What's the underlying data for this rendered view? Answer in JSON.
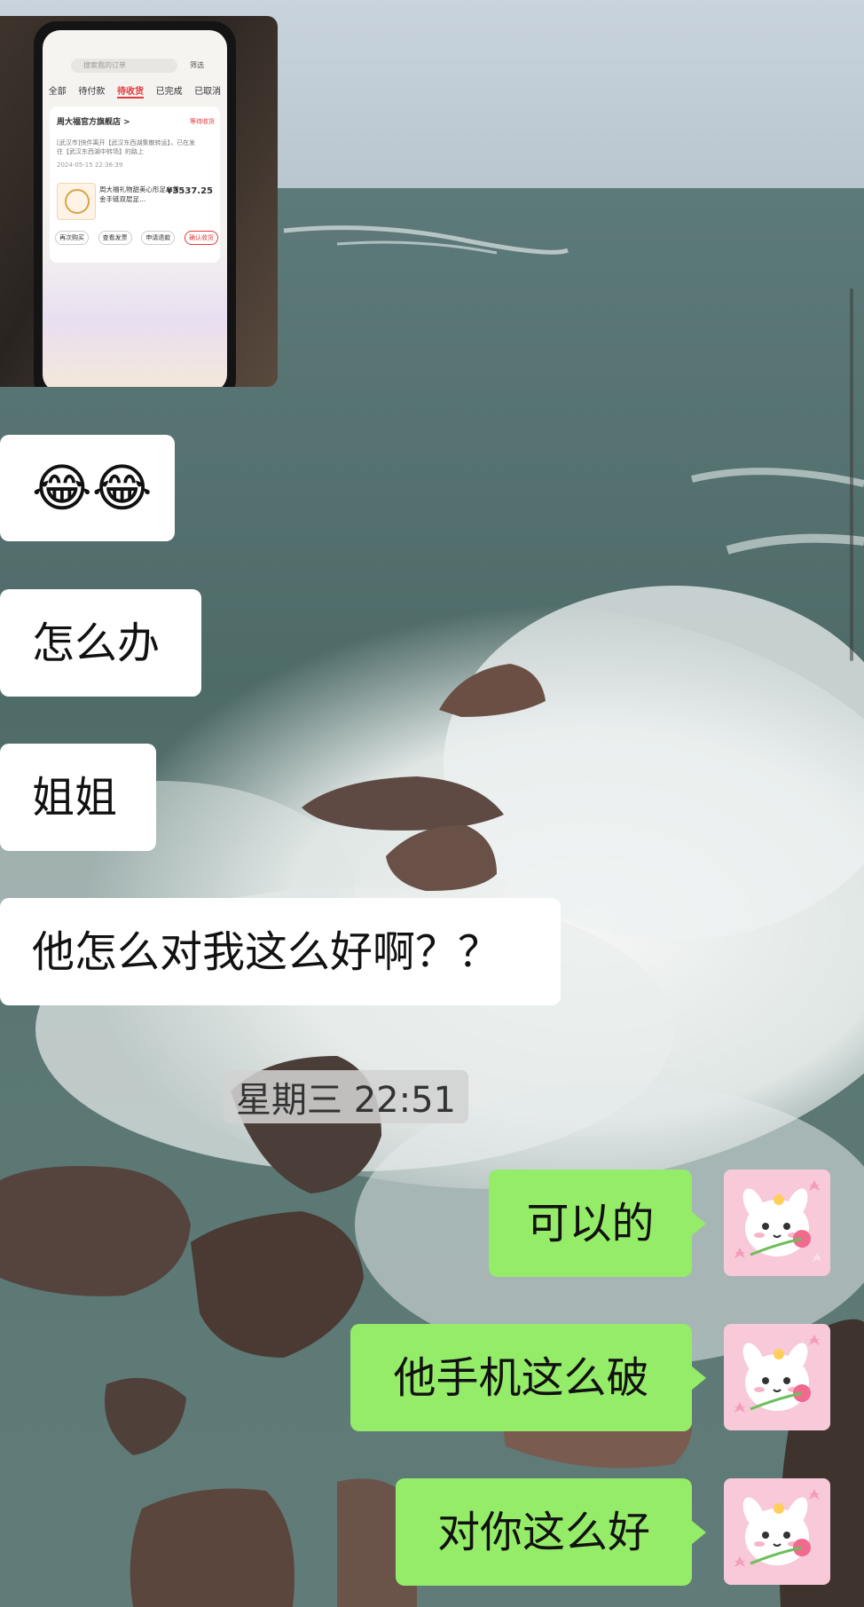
{
  "chat": {
    "image_message": {
      "screen": {
        "search_placeholder": "搜索我的订单",
        "filter_label": "筛选",
        "tabs": [
          "全部",
          "待付款",
          "待收货",
          "已完成",
          "已取消"
        ],
        "active_tab": "待收货",
        "store_name": "周大福官方旗舰店 >",
        "order_status": "等待收货",
        "tracking_text": "[武汉市]快件离开【武汉东西湖集散转运】，已在发往【武汉东西湖中转场】的路上",
        "tracking_time": "2024-05-15 22:36:39",
        "product_name": "周大福礼物甜美心形足心黄金手链双层足...",
        "price": "¥3537.25",
        "buttons": [
          "再次购买",
          "查看发票",
          "申请退款",
          "确认收货"
        ]
      }
    },
    "incoming": [
      {
        "text": "😂😂"
      },
      {
        "text": "怎么办"
      },
      {
        "text": "姐姐"
      },
      {
        "text": "他怎么对我这么好啊？？"
      }
    ],
    "timestamp": "星期三 22:51",
    "outgoing": [
      {
        "text": "可以的"
      },
      {
        "text": "他手机这么破"
      },
      {
        "text": "对你这么好"
      }
    ]
  },
  "colors": {
    "incoming_bubble": "#ffffff",
    "outgoing_bubble": "#95ec69",
    "background_sea": "#4b6a66"
  }
}
